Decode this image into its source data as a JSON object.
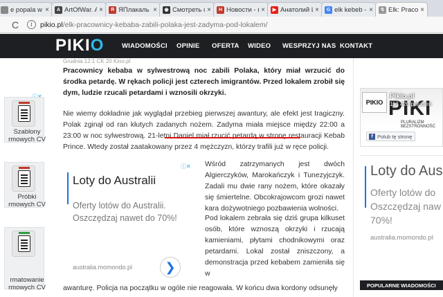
{
  "browser": {
    "tabs": [
      {
        "label": "e popala w",
        "color": "#888888",
        "glyph": ""
      },
      {
        "label": "ArtOfWar. A",
        "color": "#444444",
        "glyph": "A"
      },
      {
        "label": "ЯПлакаль -",
        "color": "#c0392b",
        "glyph": "Я"
      },
      {
        "label": "Смотреть о",
        "color": "#333333",
        "glyph": "◉"
      },
      {
        "label": "Новости - п",
        "color": "#c0392b",
        "glyph": "Н"
      },
      {
        "label": "Анатолий Ш",
        "color": "#e62117",
        "glyph": "▶"
      },
      {
        "label": "elk kebeb -",
        "color": "#4285f4",
        "glyph": "G"
      },
      {
        "label": "Elk: Pracowni",
        "color": "#999999",
        "glyph": "↯"
      }
    ],
    "tab_close": "×",
    "url_host": "pikio.pl",
    "url_path": "/elk-pracownicy-kebaba-zabili-polaka-jest-zadyma-pod-lokalem/",
    "reload_glyph": "C",
    "info_glyph": "i"
  },
  "site": {
    "logo_text": "PIKI",
    "logo_accent": "O",
    "nav": [
      "WIADOMOŚCI",
      "OPINIE",
      "OFERTA",
      "WIDEO",
      "WESPRZYJ NAS",
      "KONTAKT"
    ]
  },
  "left_ads": [
    {
      "label": "Szablony\nrmowych CV",
      "accent": "red"
    },
    {
      "label": "Próbki\nrmowych CV",
      "accent": "red"
    },
    {
      "label": "rmatowanie\nrmowych CV",
      "accent": "green"
    }
  ],
  "ad_badge": "ⓘ✕",
  "article": {
    "cut_line": "Grudnia 12:1 CK 20 Kino.pl",
    "lead": "Pracownicy kebaba w sylwestrową noc zabili Polaka, który miał wrzucić do środka petardę. W rękach policji jest czterech imigrantów. Przed lokalem zrobił się dym, ludzie rzucali petardami i wznosili okrzyki.",
    "para1": "Nie wiemy dokładnie jak wyglądał przebieg pierwszej awantury, ale efekt jest tragiczny. Polak zginął od ran kłutych zadanych nożem. Zadyma miała miejsce między 22:00 a 23:00 w noc sylwestrową. 21-letni Daniel miał rzucić petardą w stronę restauracji Kebab Prince. Wtedy został zaatakowany przez 4 mężczyzn, którzy trafili już w ręce policji.",
    "para2": "Wśród zatrzymanych jest dwóch Algierczyków, Marokańczyk i Tunezyjczyk. Zadali mu dwie rany nożem, które okazały się śmiertelne. Obcokrajowcom grozi nawet kara dożywotniego pozbawienia wolności.",
    "para3": "Pod lokalem zebrała się dziś grupa kilkuset osób, które wznoszą okrzyki i rzucają kamieniami, płytami chodnikowymi oraz petardami. Lokal został zniszczony, a demonstracja przed kebabem zamieniła się w",
    "para3_cont": "awanturę. Policja na początku w ogóle nie reagowała. W końcu dwa kordony odsunęły"
  },
  "inline_ad": {
    "title": "Loty do Australii",
    "subtitle": "Oferty lotów do Australii. Oszczędzaj nawet do 70%!",
    "domain": "australia.momondo.pl",
    "arrow": "❯",
    "badge": "ⓘ✕"
  },
  "fb_widget": {
    "thumb": "PIKIO",
    "big": "PIKI",
    "name": "Pikio.pl",
    "likes": "113 420 polubień",
    "sub": "PLURALIZM BEZSTRONNOŚĆ",
    "like_label": "Polub tę stronę",
    "like_glyph": "f"
  },
  "right_ad": {
    "title": "Loty do Aus",
    "subtitle_lines": [
      "Oferty lotów do",
      "Oszczędzaj naw",
      "70%!"
    ],
    "domain": "australia.momondo.pl"
  },
  "popular_label": "POPULARNE WIADOMOŚCI"
}
